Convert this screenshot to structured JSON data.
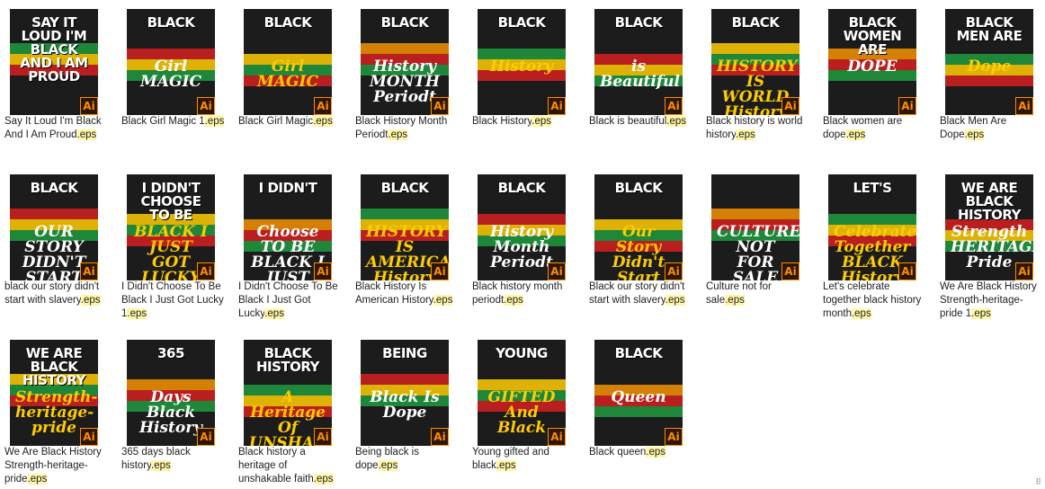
{
  "extension": ".eps",
  "badge_label": "Ai",
  "colors": {
    "green": "#1f9a3e",
    "yellow": "#ffcc00",
    "red": "#d62020",
    "orange": "#f39200",
    "dark": "#1c1c1c"
  },
  "files": [
    {
      "name": "Say It Loud I'm Black And I Am Proud",
      "art": "SAY IT LOUD I'M BLACK AND I AM PROUD",
      "art_sub": ""
    },
    {
      "name": "Black Girl Magic 1",
      "art": "BLACK",
      "art_sub": "Girl MAGIC"
    },
    {
      "name": "Black Girl Magic",
      "art": "BLACK",
      "art_sub": "Girl MAGIC"
    },
    {
      "name": "Black History Month Periodt",
      "art": "BLACK",
      "art_sub": "History MONTH Periodt"
    },
    {
      "name": "Black History",
      "art": "BLACK",
      "art_sub": "History"
    },
    {
      "name": "Black is beautiful",
      "art": "Black",
      "art_sub": "is Beautiful"
    },
    {
      "name": "Black history is world history",
      "art": "BLACK",
      "art_sub": "HISTORY IS WORLD History"
    },
    {
      "name": "Black women are dope",
      "art": "Black Women Are",
      "art_sub": "DOPE"
    },
    {
      "name": "Black Men Are Dope",
      "art": "BLACK MEN ARE",
      "art_sub": "Dope"
    },
    {
      "name": "black our story didn't start with slavery",
      "art": "BLACK",
      "art_sub": "OUR STORY DIDN'T START With SLAVERY"
    },
    {
      "name": "I Didn't Choose To Be Black I Just Got Lucky 1",
      "art": "I DIDN'T CHOOSE TO BE",
      "art_sub": "BLACK I JUST GOT LUCKY"
    },
    {
      "name": "I Didn't Choose To Be Black I Just Got Lucky",
      "art": "I DIDN'T",
      "art_sub": "Choose TO BE BLACK I JUST GOT LUCKY"
    },
    {
      "name": "Black History Is American History",
      "art": "BLACK",
      "art_sub": "HISTORY IS AMERICAN History"
    },
    {
      "name": "Black history month periodt",
      "art": "Black",
      "art_sub": "History Month Periodt"
    },
    {
      "name": "Black our story didn't start with slavery",
      "art": "Black",
      "art_sub": "Our Story Didn't Start With Slavery"
    },
    {
      "name": "Culture not for sale",
      "art": "",
      "art_sub": "CULTURE NOT FOR SALE"
    },
    {
      "name": "Let's celebrate together black history month",
      "art": "LET'S",
      "art_sub": "Celebrate Together BLACK History MONTH"
    },
    {
      "name": "We Are Black History Strength-heritage-pride 1",
      "art": "WE ARE BLACK HISTORY",
      "art_sub": "Strength HERITAGE Pride"
    },
    {
      "name": "We Are Black History Strength-heritage-pride",
      "art": "WE ARE BLACK HISTORY",
      "art_sub": "Strength-heritage-pride"
    },
    {
      "name": "365 days black history",
      "art": "365",
      "art_sub": "Days Black History"
    },
    {
      "name": "Black history a heritage of unshakable faith",
      "art": "Black History",
      "art_sub": "A Heritage Of UNSHAKABLE Faith"
    },
    {
      "name": "Being black is dope",
      "art": "Being",
      "art_sub": "Black Is Dope"
    },
    {
      "name": "Young gifted and black",
      "art": "Young",
      "art_sub": "GIFTED And Black"
    },
    {
      "name": "Black queen",
      "art": "BLACK",
      "art_sub": "Queen"
    }
  ]
}
